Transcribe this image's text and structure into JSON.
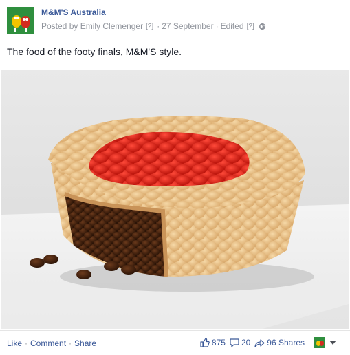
{
  "post": {
    "page_name": "M&M'S Australia",
    "posted_by": "Posted by Emily Clemenger",
    "qmark1": "[?]",
    "date": "27 September",
    "edited": "Edited",
    "qmark2": "[?]",
    "separator": "·",
    "audience_icon": "globe-icon",
    "message": "The food of the footy finals, M&M'S style."
  },
  "photo": {
    "description_icon": "pie-made-of-mms"
  },
  "footer": {
    "like_label": "Like",
    "comment_label": "Comment",
    "share_label": "Share",
    "separator": "·",
    "likes_count": "875",
    "comments_count": "20",
    "shares_count": "96 Shares"
  }
}
